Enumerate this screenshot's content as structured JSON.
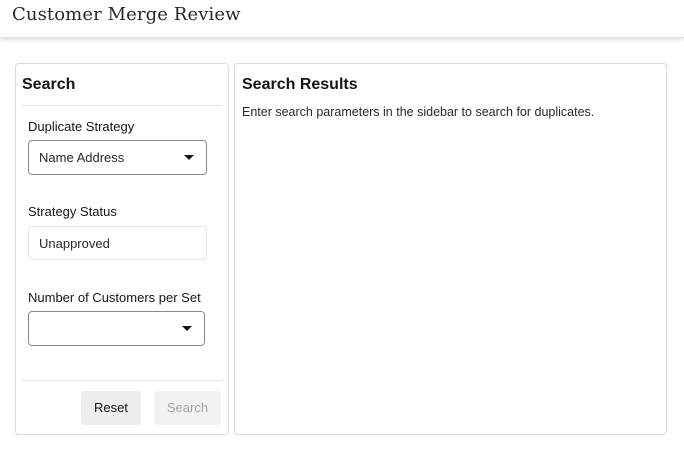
{
  "header": {
    "title": "Customer Merge Review"
  },
  "sidebar": {
    "heading": "Search",
    "duplicate_strategy": {
      "label": "Duplicate Strategy",
      "value": "Name Address"
    },
    "strategy_status": {
      "label": "Strategy Status",
      "value": "Unapproved"
    },
    "customers_per_set": {
      "label": "Number of Customers per Set",
      "value": ""
    },
    "buttons": {
      "reset": "Reset",
      "search": "Search"
    }
  },
  "results": {
    "heading": "Search Results",
    "message": "Enter search parameters in the sidebar to search for duplicates."
  },
  "icons": {
    "dropdown": "chevron-down-icon"
  },
  "colors": {
    "text": "#161513",
    "border": "#dddad6",
    "input_border": "#8d8983",
    "reset_bg": "#eeedeb",
    "disabled_text": "#a7a39e"
  }
}
